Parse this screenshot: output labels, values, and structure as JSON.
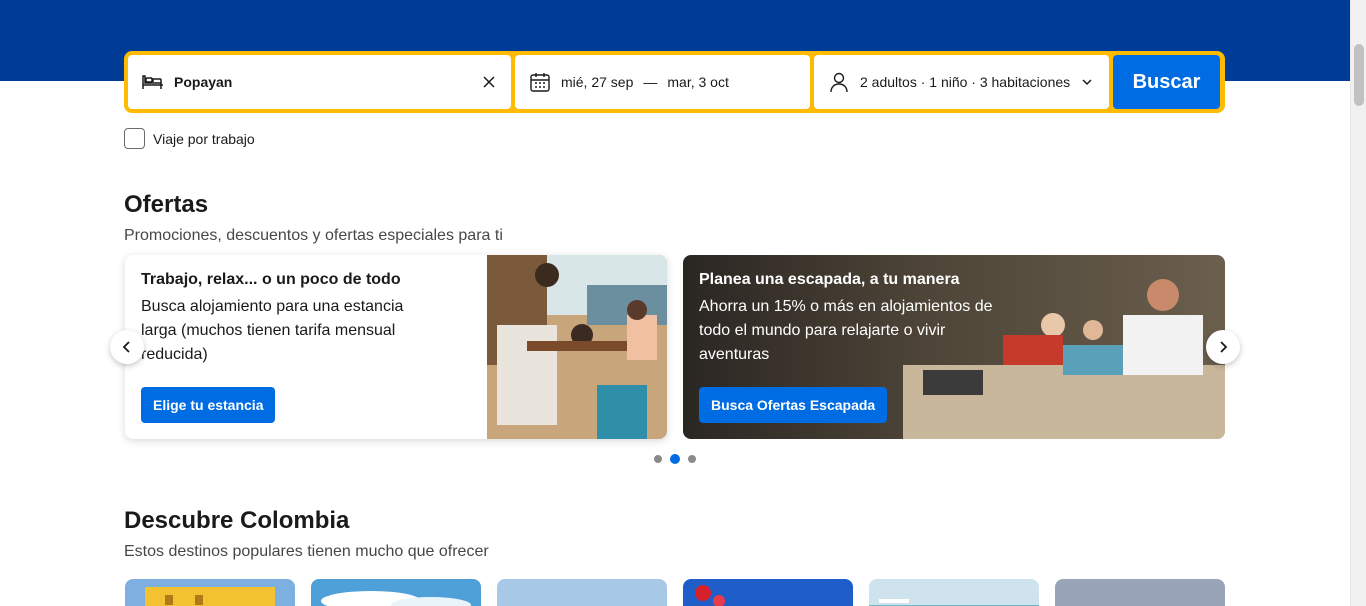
{
  "search": {
    "destination": "Popayan",
    "checkin": "mié, 27 sep",
    "dash": "—",
    "checkout": "mar, 3 oct",
    "occupancy": "2 adultos · 1 niño · 3 habitaciones",
    "button_label": "Buscar"
  },
  "business_trip": {
    "label": "Viaje por trabajo"
  },
  "offers": {
    "title": "Ofertas",
    "subtitle": "Promociones, descuentos y ofertas especiales para ti",
    "cards": [
      {
        "title": "Trabajo, relax... o un poco de todo",
        "body": "Busca alojamiento para una estancia larga (muchos tienen tarifa mensual reducida)",
        "button": "Elige tu estancia"
      },
      {
        "title": "Planea una escapada, a tu manera",
        "body": "Ahorra un 15% o más en alojamientos de todo el mundo para relajarte o vivir aventuras",
        "button": "Busca Ofertas Escapada"
      }
    ],
    "active_dot": 2
  },
  "discover": {
    "title": "Descubre Colombia",
    "subtitle": "Estos destinos populares tienen mucho que ofrecer"
  },
  "colors": {
    "brand_blue": "#003b95",
    "accent_yellow": "#febb02",
    "button_blue": "#006ce4"
  }
}
